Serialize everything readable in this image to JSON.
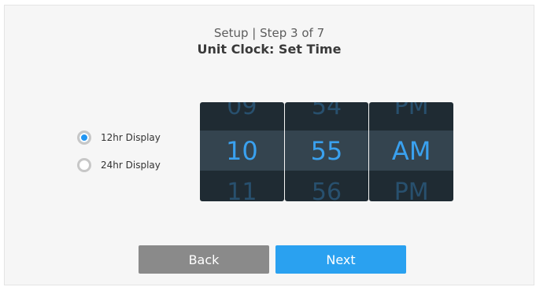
{
  "header": {
    "step_text": "Setup | Step 3 of 7",
    "title": "Unit Clock: Set Time"
  },
  "display_mode": {
    "options": [
      {
        "label": "12hr Display",
        "selected": true
      },
      {
        "label": "24hr Display",
        "selected": false
      }
    ]
  },
  "time_picker": {
    "hour": {
      "prev": "09",
      "current": "10",
      "next": "11"
    },
    "minute": {
      "prev": "54",
      "current": "55",
      "next": "56"
    },
    "period": {
      "prev": "PM",
      "current": "AM",
      "next": "PM"
    }
  },
  "buttons": {
    "back_label": "Back",
    "next_label": "Next"
  },
  "colors": {
    "accent": "#2aa1f0",
    "secondary_button": "#8a8a8a",
    "picker_bg": "#1f2b33",
    "picker_selected_band": "#34444f"
  }
}
